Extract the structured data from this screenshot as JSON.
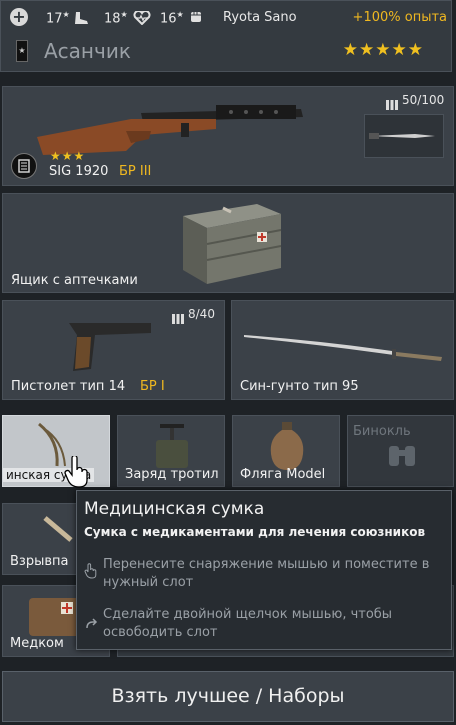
{
  "header": {
    "stat1": "17",
    "stat2": "18",
    "stat3": "16",
    "player_name": "Ryota Sano",
    "exp_bonus": "+100% опыта",
    "squad_name": "Асанчик",
    "rating_stars": "★★★★★"
  },
  "primary_weapon": {
    "name": "SIG 1920",
    "tier": "БР III",
    "stars": "★★★",
    "ammo": "50/100"
  },
  "equipment": {
    "label": "Ящик с аптечками"
  },
  "pistol": {
    "name": "Пистолет тип 14",
    "tier": "БР I",
    "ammo": "8/40"
  },
  "melee": {
    "name": "Син-гунто тип 95"
  },
  "small_slots": [
    {
      "label": "инская сумка"
    },
    {
      "label": "Заряд тротил"
    },
    {
      "label": "Фляга Model"
    },
    {
      "label": "Бинокль"
    }
  ],
  "lower_slots": [
    {
      "label": "Взрывпа"
    },
    {
      "label": "Медком"
    }
  ],
  "tooltip": {
    "title": "Медицинская сумка",
    "subtitle": "Сумка с медикаментами для лечения союзников",
    "hint1": "Перенесите снаряжение мышью и поместите в нужный слот",
    "hint2": "Сделайте двойной щелчок мышью, чтобы освободить слот"
  },
  "bottom_button": "Взять лучшее / Наборы",
  "colors": {
    "accent": "#f0b820",
    "panel": "#3b4148",
    "background": "#1e2226"
  }
}
